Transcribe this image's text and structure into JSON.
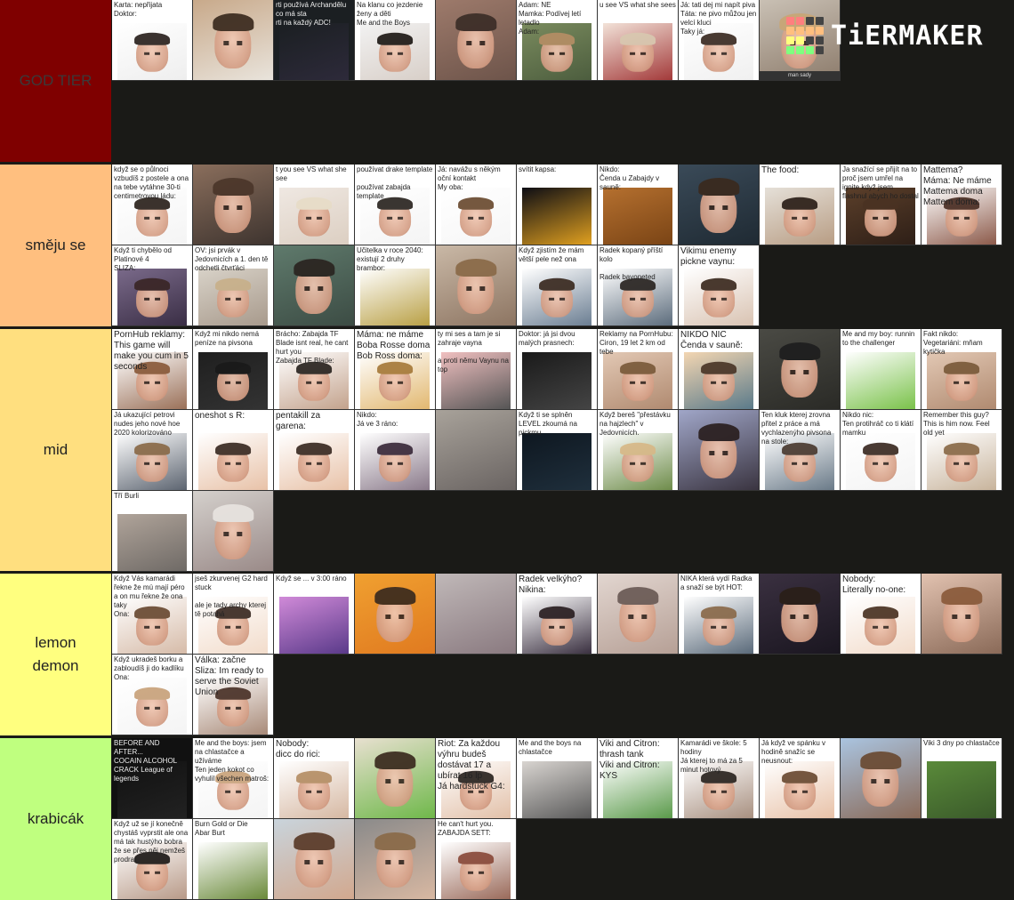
{
  "logo": {
    "text": "TiERMAKER",
    "grid_colors": [
      [
        "#ff7f7f",
        "#ff7f7f",
        "#444444",
        "#444444"
      ],
      [
        "#ffbf7f",
        "#ffbf7f",
        "#ffbf7f",
        "#ffbf7f"
      ],
      [
        "#ffff7f",
        "#ffff7f",
        "#444444",
        "#444444"
      ],
      [
        "#7fff7f",
        "#7fff7f",
        "#7fff7f",
        "#444444"
      ]
    ]
  },
  "tiers": [
    {
      "label": "GOD TIER",
      "color": "#7f0000",
      "label_color": "#3a3a3a",
      "items": [
        {
          "caption": "Karta: nepřijata\nDoktor:",
          "c1": "#ffffff",
          "c2": "#eeeeee",
          "hair": "#2a221e"
        },
        {
          "caption": "",
          "c1": "#c8a98a",
          "c2": "#e9e4dc",
          "hair": "#3a2a1e",
          "full": true
        },
        {
          "caption": "rti používá Archandělu co má sta\nrti na každý ADC!",
          "c1": "#1b1f22",
          "c2": "#2d2a3a",
          "face": false,
          "full_dark": true
        },
        {
          "caption": "Na klanu co jezdenie ženy a děti\nMe and the Boys",
          "c1": "#f2f2f2",
          "c2": "#d8cfc8",
          "hair": "#1e1915"
        },
        {
          "caption": "",
          "c1": "#9d7a6b",
          "c2": "#6d544a",
          "hair": "#3b2d27",
          "full": true
        },
        {
          "caption": "Adam: NE\nMamka: Podívej letí letadlo\nAdam:",
          "c1": "#7a8b5e",
          "c2": "#4c5d3e",
          "hair": "#b58e65"
        },
        {
          "caption": "u see VS what she sees",
          "c1": "#f2e2d8",
          "c2": "#a33a3a",
          "hair": "#d8c8b0"
        },
        {
          "caption": "Já: tati dej mi napít piva\nTáta: ne pivo můžou jen velcí kluci\nTaky já:",
          "c1": "#ffffff",
          "c2": "#f0f0f0",
          "hair": "#3a2a22"
        },
        {
          "caption": "",
          "c1": "#c9c0b4",
          "c2": "#8d7c6c",
          "hair": "#c9a675",
          "full": true,
          "bottom_caption": "man sady"
        }
      ]
    },
    {
      "label": "směju se",
      "color": "#ffbf7f",
      "label_color": "#222222",
      "items": [
        {
          "caption": "když se o půlnoci vzbudíš z postele a ona na tebe vytáhne 30-ti centimetrovou ládu:",
          "c1": "#ffffff",
          "c2": "#f4f4f4",
          "hair": "#2b221c"
        },
        {
          "caption": "",
          "c1": "#8a6e5c",
          "c2": "#3e342f",
          "hair": "#4b362a",
          "full": true
        },
        {
          "caption": "t you see VS what she see",
          "c1": "#efe8e2",
          "c2": "#dccfc2",
          "hair": "#e7dcc7"
        },
        {
          "caption": "používat drake template\n\npoužívat zabajda template",
          "c1": "#ffffff",
          "c2": "#f4f4f4",
          "hair": "#2a2520"
        },
        {
          "caption": "Já: navážu s někým oční kontakt\nMy oba:",
          "c1": "#ffffff",
          "c2": "#f6f6f6",
          "hair": "#6a4b30"
        },
        {
          "caption": "svítit kapsa:",
          "c1": "#0d0d14",
          "c2": "#e0a020",
          "face": false
        },
        {
          "caption": "Nikdo:\nČenda u Zabajdy v sauně:",
          "c1": "#b5702f",
          "c2": "#7a4415",
          "face": false
        },
        {
          "caption": "",
          "c1": "#3a4a58",
          "c2": "#1f2a33",
          "hair": "#3a2a1e",
          "full": true
        },
        {
          "caption": "The food:",
          "c1": "#e5e0d8",
          "c2": "#b89d84",
          "hair": "#2b1f18",
          "big": true
        },
        {
          "caption": "Ja snažící se přijít na to proč jsem umřel na ignite když jsem flashnul abych ho dostal",
          "c1": "#5b3f2a",
          "c2": "#2e1f17",
          "hair": "#4a3222"
        },
        {
          "caption": "Mattema?\nMáma: Ne máme Mattema doma\nMattem doma:",
          "c1": "#ffffff",
          "c2": "#8c5a4a",
          "hair": "#4b2f25",
          "big": true
        },
        {
          "caption": "Když ti chybělo od Platinové 4\nSLIZA:",
          "c1": "#7a6a8a",
          "c2": "#3a2e45",
          "hair": "#3a2626"
        },
        {
          "caption": "OV: jsi prvák v Jedovnicích a 1. den tě odchetli čtvrťáci",
          "c1": "#d8d2c8",
          "c2": "#a89a8c",
          "hair": "#c8b08a"
        },
        {
          "caption": "",
          "c1": "#5f7a6c",
          "c2": "#3c4c44",
          "hair": "#2a2420",
          "full": true
        },
        {
          "caption": "Učitelka v roce 2040:\nexistují 2 druhy brambor:",
          "c1": "#ffffff",
          "c2": "#b9a045",
          "face": false
        },
        {
          "caption": "",
          "c1": "#c9b8a6",
          "c2": "#8d7562",
          "hair": "#8a6a48",
          "full": true
        },
        {
          "caption": "Když zjistím že mám větší pele než ona",
          "c1": "#ffffff",
          "c2": "#6b7e92",
          "hair": "#3a2a20"
        },
        {
          "caption": "Radek kopaný příští kolo\n\nRadek bayoneted",
          "c1": "#ffffff",
          "c2": "#5c6c7c",
          "hair": "#2a2522"
        },
        {
          "caption": "Vikimu enemy pickne vaynu:",
          "c1": "#ffffff",
          "c2": "#d9c3b2",
          "hair": "#3b2a1f",
          "big": true
        }
      ]
    },
    {
      "label": "mid",
      "color": "#ffdf7f",
      "label_color": "#222222",
      "items": [
        {
          "caption": "PornHub reklamy: This game will make you cum in 5 seconds",
          "c1": "#ffffff",
          "c2": "#9a7058",
          "hair": "#8a5a3a",
          "big": true
        },
        {
          "caption": "Když mi nikdo nemá peníze na pivsona",
          "c1": "#1f1f1f",
          "c2": "#333333",
          "hair": "#1a1a1a"
        },
        {
          "caption": "Brácho: Zabajda TF Blade isnt real, he cant hurt you\nZabajda TF Blade:",
          "c1": "#ffffff",
          "c2": "#c3a28c",
          "hair": "#2a2420"
        },
        {
          "caption": "Máma: ne máme Boba Rosse doma\nBob Ross doma:",
          "c1": "#ffffff",
          "c2": "#e2b870",
          "hair": "#a67a3a",
          "big": true
        },
        {
          "caption": "ty mi ses a tam je si zahraje vayna\n\na proti němu Vaynu na top",
          "c1": "#f0c0c0",
          "c2": "#555555",
          "face": false
        },
        {
          "caption": "Doktor: já jsi dvou malých prasnech:",
          "c1": "#1a1a1a",
          "c2": "#444444",
          "face": false
        },
        {
          "caption": "Reklamy na PornHubu:\nCiron, 19 let 2 km od tebe",
          "c1": "#e2c8b4",
          "c2": "#b08a70",
          "hair": "#7a5a3a"
        },
        {
          "caption": "NIKDO NIC\nČenda v sauně:",
          "c1": "#f3d6b2",
          "c2": "#5a7a8a",
          "hair": "#4a3628",
          "big": true
        },
        {
          "caption": "",
          "c1": "#4a4a44",
          "c2": "#2a2a26",
          "hair": "#1e1e1e",
          "full": true
        },
        {
          "caption": "Me and my boy: runnin to the challenger",
          "c1": "#ffffff",
          "c2": "#7ac24a",
          "face": false
        },
        {
          "caption": "Fakt nikdo:\nVegetariáni: mňam kytička",
          "c1": "#e2c8b4",
          "c2": "#b08a70",
          "hair": "#7a5a3a"
        },
        {
          "caption": "Já ukazující petrovi nudes jeho nové hoe 2020 kolorizováno",
          "c1": "#ffffff",
          "c2": "#5c6470",
          "hair": "#8a6a48"
        },
        {
          "caption": "oneshot s R:",
          "c1": "#ffffff",
          "c2": "#e8c2a8",
          "hair": "#3a2a22",
          "big": true
        },
        {
          "caption": "pentakill za garena:",
          "c1": "#ffffff",
          "c2": "#e8c2a8",
          "hair": "#3a2a22",
          "big": true
        },
        {
          "caption": "Nikdo:\nJá ve 3 ráno:",
          "c1": "#ffffff",
          "c2": "#8a7a8a",
          "hair": "#3a2a3a"
        },
        {
          "caption": "",
          "c1": "#a8a29a",
          "c2": "#6a6462",
          "face": false,
          "full": true
        },
        {
          "caption": "Když ti se splněn LEVEL zkoumá na pickmu",
          "c1": "#0e1720",
          "c2": "#1f2f3c",
          "face": false
        },
        {
          "caption": "Když bereš \"přestávku na hajzlech\" v Jedovnicích.",
          "c1": "#ffffff",
          "c2": "#6e8c4a",
          "hair": "#d7b887"
        },
        {
          "caption": "",
          "c1": "#a0a6c8",
          "c2": "#3a3440",
          "hair": "#2a1f1f",
          "full": true
        },
        {
          "caption": "Ten kluk kterej zrovna přitel z práce a má vychlazenýho pivsona na stole:",
          "c1": "#ffffff",
          "c2": "#6a7a88",
          "hair": "#4a3a30"
        },
        {
          "caption": "Nikdo nic:\nTen protihráč co ti klátí mamku",
          "c1": "#ffffff",
          "c2": "#f4f4f4",
          "hair": "#3a2a22"
        },
        {
          "caption": "Remember this guy? This is him now. Feel old yet",
          "c1": "#ffffff",
          "c2": "#c8b49c",
          "hair": "#8a6a48"
        },
        {
          "caption": "Tří Burli",
          "c1": "#b0a49a",
          "c2": "#6f6a66",
          "face": false
        },
        {
          "caption": "",
          "c1": "#d4d0cc",
          "c2": "#9a8a88",
          "hair": "#e8e4e0",
          "full": true
        }
      ]
    },
    {
      "label": "lemon\ndemon",
      "color": "#ffff7f",
      "label_color": "#222222",
      "items": [
        {
          "caption": "Když Vás kamarádi řekne že mú mají péro a on mu řekne že ona taky\nOna:",
          "c1": "#ffffff",
          "c2": "#d6bba8",
          "hair": "#6a4a32"
        },
        {
          "caption": "jseš zkurvenej G2 hard stuck\n\nale je tady archy kterej tě potahá",
          "c1": "#ffffff",
          "c2": "#f2dccb",
          "hair": "#3a2a22"
        },
        {
          "caption": "Když se ... v 3:00 ráno",
          "c1": "#d08ad8",
          "c2": "#5a3a8a",
          "face": false
        },
        {
          "caption": "",
          "c1": "#f0a030",
          "c2": "#e07a20",
          "hair": "#3a2a1e",
          "full": true
        },
        {
          "caption": "",
          "c1": "#c0b8b8",
          "c2": "#8a7a80",
          "face": false,
          "full": true
        },
        {
          "caption": "Radek velkýho?\nNikina:",
          "c1": "#ffffff",
          "c2": "#3a3040",
          "hair": "#2a1f22",
          "big": true
        },
        {
          "caption": "",
          "c1": "#e2d6d0",
          "c2": "#b6a096",
          "hair": "#6a5a55",
          "full": true
        },
        {
          "caption": "NIKA která vydí Radka a snaží se být HOT:",
          "c1": "#ffffff",
          "c2": "#5a6a7a",
          "hair": "#8a6a4a"
        },
        {
          "caption": "",
          "c1": "#3a3040",
          "c2": "#1a1620",
          "hair": "#2a1f18",
          "full": true
        },
        {
          "caption": "Nobody:\nLiterally no-one:",
          "c1": "#ffffff",
          "c2": "#f2dccb",
          "hair": "#4a3222",
          "big": true
        },
        {
          "caption": "",
          "c1": "#e2c2b0",
          "c2": "#8a6a58",
          "hair": "#8a5a3a",
          "full": true
        },
        {
          "caption": "Když ukradeš borku a zabloudíš ji do kadlíku\nOna:",
          "c1": "#ffffff",
          "c2": "#f4f4f4",
          "hair": "#c8a27a"
        },
        {
          "caption": "Válka: začne\nSliza: Im ready to serve the Soviet Union",
          "c1": "#ffffff",
          "c2": "#a88a78",
          "hair": "#4a3228",
          "big": true
        }
      ]
    },
    {
      "label": "krabicák",
      "color": "#bfff7f",
      "label_color": "#222222",
      "items": [
        {
          "caption": "BEFORE AND AFTER...\nCOCAIN   ALCOHOL\nCRACK   League of legends",
          "c1": "#111111",
          "c2": "#222222",
          "face": false,
          "dark_caption": true
        },
        {
          "caption": "Me and the boys: jsem na chlastačce a užíváme\nTen jeden kokot co vyhulil všechen matroš:",
          "c1": "#ffffff",
          "c2": "#f4f4f4",
          "hair": "#c8a27a"
        },
        {
          "caption": "Nobody:\ndicc do rici:",
          "c1": "#ffffff",
          "c2": "#d6b8a2",
          "hair": "#b58e65",
          "big": true
        },
        {
          "caption": "",
          "c1": "#e8e0d0",
          "c2": "#6fb84a",
          "hair": "#3a2a1e",
          "full": true
        },
        {
          "caption": "Riot: Za každou výhru budeš dostávat 17 a ubírat 16 lp\nJá hardstuck G4:",
          "c1": "#ffffff",
          "c2": "#e2c0a8",
          "hair": "#2a2420",
          "big": true
        },
        {
          "caption": "Me and the boys na chlastačce",
          "c1": "#d8d4d0",
          "c2": "#5a5a5a",
          "face": false
        },
        {
          "caption": "Viki and Citron: thrash tank\nViki and Citron:\nKYS",
          "c1": "#ffffff",
          "c2": "#5a9a4a",
          "face": false,
          "big": true
        },
        {
          "caption": "Kamarádi ve škole: 5 hodiny\nJá kterej to má za 5 minut hotový",
          "c1": "#ffffff",
          "c2": "#a89080",
          "hair": "#2a2420"
        },
        {
          "caption": "Já když ve spánku v hodině snažíc se neusnout:",
          "c1": "#ffffff",
          "c2": "#e8c2a8",
          "hair": "#6a4a32"
        },
        {
          "caption": "",
          "c1": "#aac4e0",
          "c2": "#8a6a58",
          "hair": "#6a4a32",
          "full": true
        },
        {
          "caption": "Viki 3 dny po chlastačce",
          "c1": "#5a8a3a",
          "c2": "#3a5a2a",
          "face": false
        },
        {
          "caption": "Když už se jí konečně chystáš vyprstit ale ona má tak hustýho bobra že se přes něj nemžeš prodrat",
          "c1": "#ffffff",
          "c2": "#b89a88",
          "hair": "#1e1a18"
        },
        {
          "caption": "Burn Gold or Die\nAbar Burt",
          "c1": "#ffffff",
          "c2": "#6a8a3a",
          "face": false
        },
        {
          "caption": "",
          "c1": "#c9d4dc",
          "c2": "#d2a88e",
          "hair": "#5a3a28",
          "full": true
        },
        {
          "caption": "",
          "c1": "#8a8a8a",
          "c2": "#d8b8a2",
          "hair": "#8a6a48",
          "full": true
        },
        {
          "caption": "He can't hurt you.\nZABAJDA SETT:",
          "c1": "#ffffff",
          "c2": "#9a6a5a",
          "hair": "#8a4a3a"
        }
      ]
    }
  ]
}
